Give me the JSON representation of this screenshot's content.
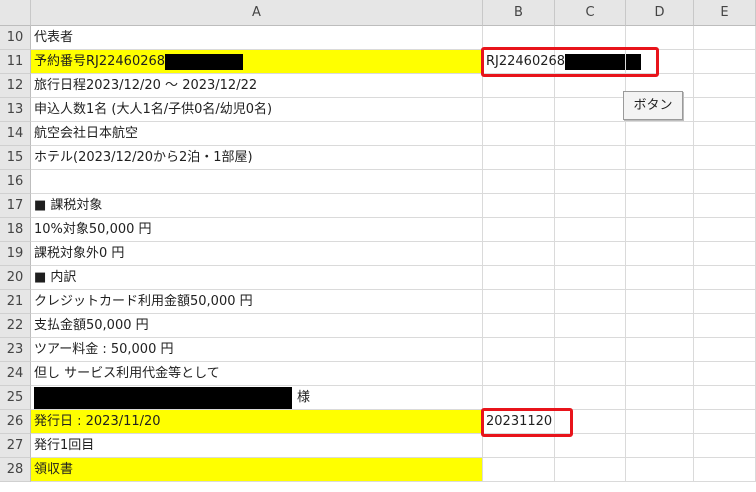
{
  "columns": [
    "A",
    "B",
    "C",
    "D",
    "E"
  ],
  "rows": [
    {
      "num": "10",
      "a": "代表者"
    },
    {
      "num": "11",
      "a": "予約番号RJ22460268",
      "b": "RJ22460268"
    },
    {
      "num": "12",
      "a": "旅行日程2023/12/20 〜 2023/12/22"
    },
    {
      "num": "13",
      "a": "申込人数1名 (大人1名/子供0名/幼児0名)"
    },
    {
      "num": "14",
      "a": "航空会社日本航空"
    },
    {
      "num": "15",
      "a": "ホテル(2023/12/20から2泊・1部屋)"
    },
    {
      "num": "16",
      "a": ""
    },
    {
      "num": "17",
      "a": "■ 課税対象"
    },
    {
      "num": "18",
      "a": "10%対象50,000 円"
    },
    {
      "num": "19",
      "a": "課税対象外0 円"
    },
    {
      "num": "20",
      "a": "■ 内訳"
    },
    {
      "num": "21",
      "a": "クレジットカード利用金額50,000 円"
    },
    {
      "num": "22",
      "a": "支払金額50,000 円"
    },
    {
      "num": "23",
      "a": "ツアー料金 : 50,000 円"
    },
    {
      "num": "24",
      "a": "但し サービス利用代金等として"
    },
    {
      "num": "25",
      "a": "様"
    },
    {
      "num": "26",
      "a": "発行日 : 2023/11/20",
      "b": "20231120"
    },
    {
      "num": "27",
      "a": "発行1回目"
    },
    {
      "num": "28",
      "a": "領収書"
    }
  ],
  "button": {
    "label": "ボタン"
  },
  "colors": {
    "highlight": "#ffff00",
    "annotation": "#e8141b"
  }
}
